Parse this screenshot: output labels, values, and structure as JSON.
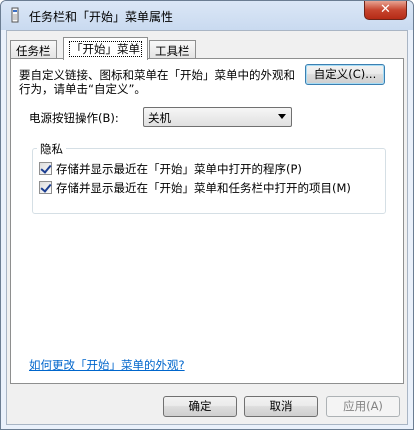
{
  "window": {
    "title": "任务栏和「开始」菜单属性",
    "close_glyph": "✕"
  },
  "tabs": [
    {
      "label": "任务栏"
    },
    {
      "label": "「开始」菜单"
    },
    {
      "label": "工具栏"
    }
  ],
  "start_menu": {
    "description": "要自定义链接、图标和菜单在「开始」菜单中的外观和行为，请单击“自定义”。",
    "customize_label": "自定义(C)...",
    "power_label": "电源按钮操作(B):",
    "power_value": "关机",
    "privacy_label": "隐私",
    "privacy_options": [
      {
        "label": "存储并显示最近在「开始」菜单中打开的程序(P)",
        "checked": true
      },
      {
        "label": "存储并显示最近在「开始」菜单和任务栏中打开的项目(M)",
        "checked": true
      }
    ],
    "help_link": "如何更改「开始」菜单的外观?"
  },
  "footer": {
    "ok_label": "确定",
    "cancel_label": "取消",
    "apply_label": "应用(A)"
  }
}
